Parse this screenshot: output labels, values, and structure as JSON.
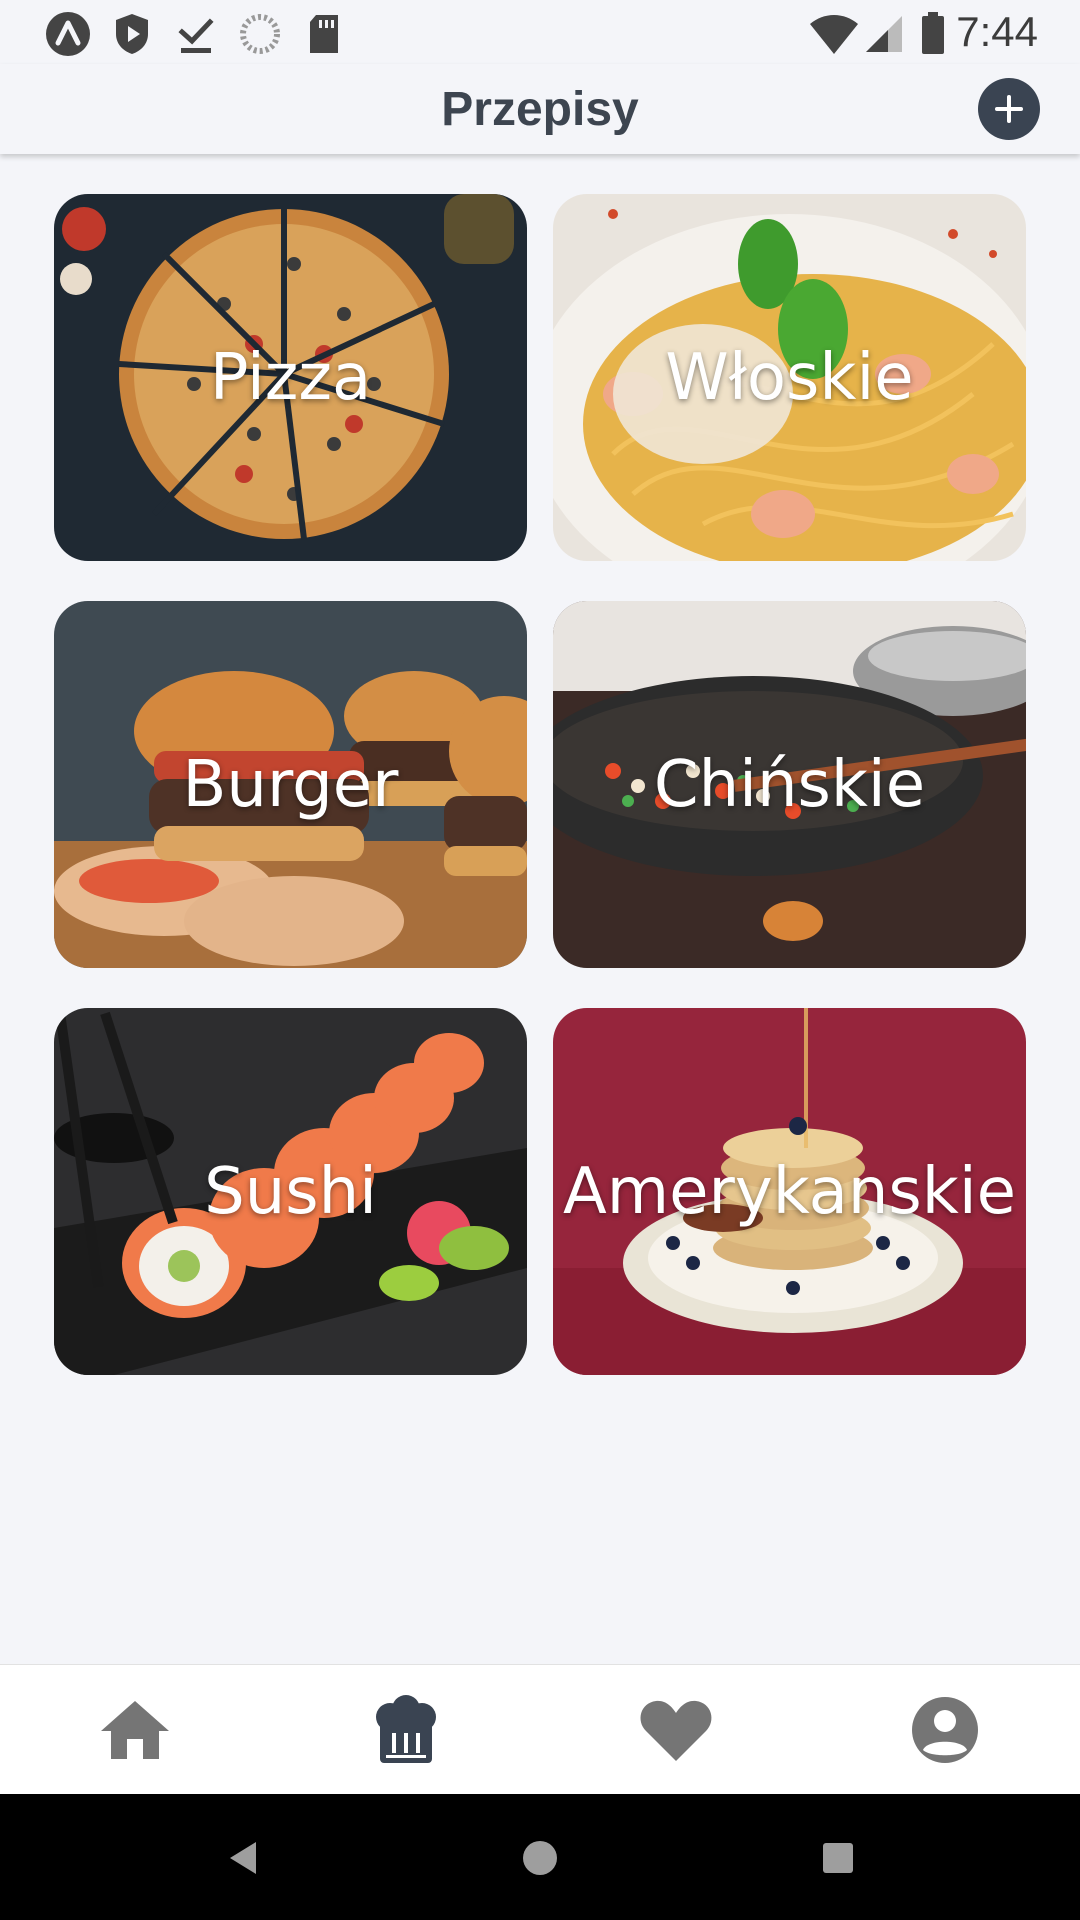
{
  "status_bar": {
    "time": "7:44",
    "icons": [
      "a-badge-icon",
      "shield-play-icon",
      "download-done-icon",
      "loading-circle-icon",
      "sd-card-icon",
      "wifi-icon",
      "signal-icon",
      "battery-icon"
    ]
  },
  "header": {
    "title": "Przepisy",
    "add_icon": "plus-circle-icon"
  },
  "categories": [
    {
      "label": "Pizza"
    },
    {
      "label": "Włoskie"
    },
    {
      "label": "Burger"
    },
    {
      "label": "Chińskie"
    },
    {
      "label": "Sushi"
    },
    {
      "label": "Amerykanskie"
    }
  ],
  "bottom_nav": {
    "items": [
      {
        "icon": "home-icon",
        "active": false
      },
      {
        "icon": "chef-hat-icon",
        "active": true
      },
      {
        "icon": "heart-icon",
        "active": false
      },
      {
        "icon": "account-icon",
        "active": false
      }
    ],
    "active_color": "#3a4452",
    "inactive_color": "#757575"
  },
  "system_nav": {
    "icons": [
      "back-icon",
      "home-circle-icon",
      "recents-icon"
    ]
  }
}
